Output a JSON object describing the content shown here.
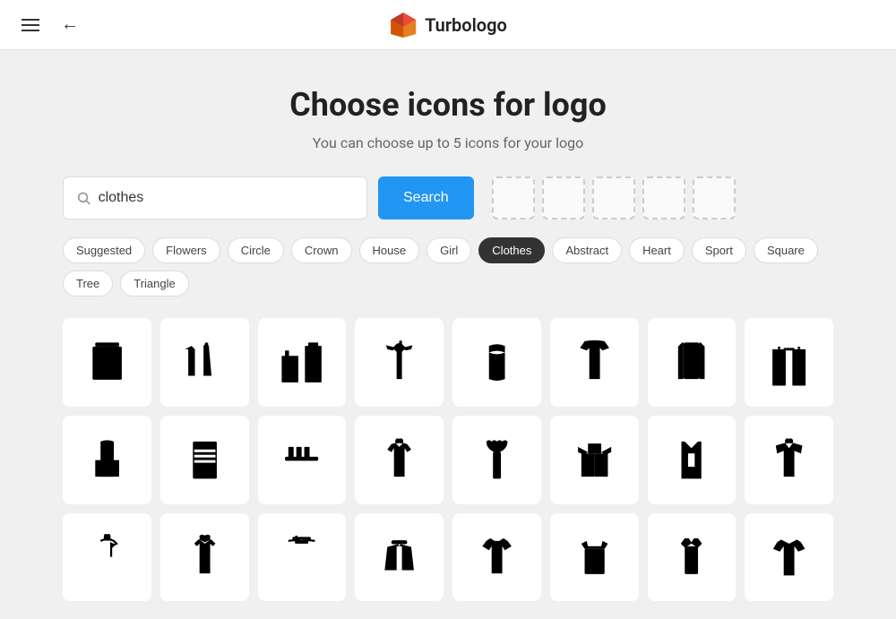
{
  "header": {
    "logo_text": "Turbologo",
    "back_label": "←",
    "menu_icon": "menu-icon"
  },
  "page": {
    "title": "Choose icons for logo",
    "subtitle": "You can choose up to 5 icons for your logo"
  },
  "search": {
    "value": "clothes",
    "placeholder": "Search",
    "button_label": "Search"
  },
  "filters": [
    {
      "label": "Suggested",
      "active": false
    },
    {
      "label": "Flowers",
      "active": false
    },
    {
      "label": "Circle",
      "active": false
    },
    {
      "label": "Crown",
      "active": false
    },
    {
      "label": "House",
      "active": false
    },
    {
      "label": "Girl",
      "active": false
    },
    {
      "label": "Clothes",
      "active": true
    },
    {
      "label": "Abstract",
      "active": false
    },
    {
      "label": "Heart",
      "active": false
    },
    {
      "label": "Sport",
      "active": false
    },
    {
      "label": "Square",
      "active": false
    },
    {
      "label": "Tree",
      "active": false
    },
    {
      "label": "Triangle",
      "active": false
    }
  ],
  "icon_slots": [
    1,
    2,
    3,
    4,
    5
  ],
  "icons": [
    "shirt-full",
    "clothes-set",
    "pants-shirt",
    "tshirt-hanger",
    "dress-short",
    "clothes-rack",
    "coat",
    "pants-pair",
    "dungarees",
    "vest-stripes",
    "fold-clothes",
    "skirt-hanger",
    "dress-black",
    "shorts-tshirt",
    "coat-open",
    "tshirt-hanger2",
    "hanger1",
    "hanger2",
    "tie",
    "tshirt-simple",
    "tshirt-open",
    "shirt-formal",
    "vest",
    "pants-shorts"
  ]
}
